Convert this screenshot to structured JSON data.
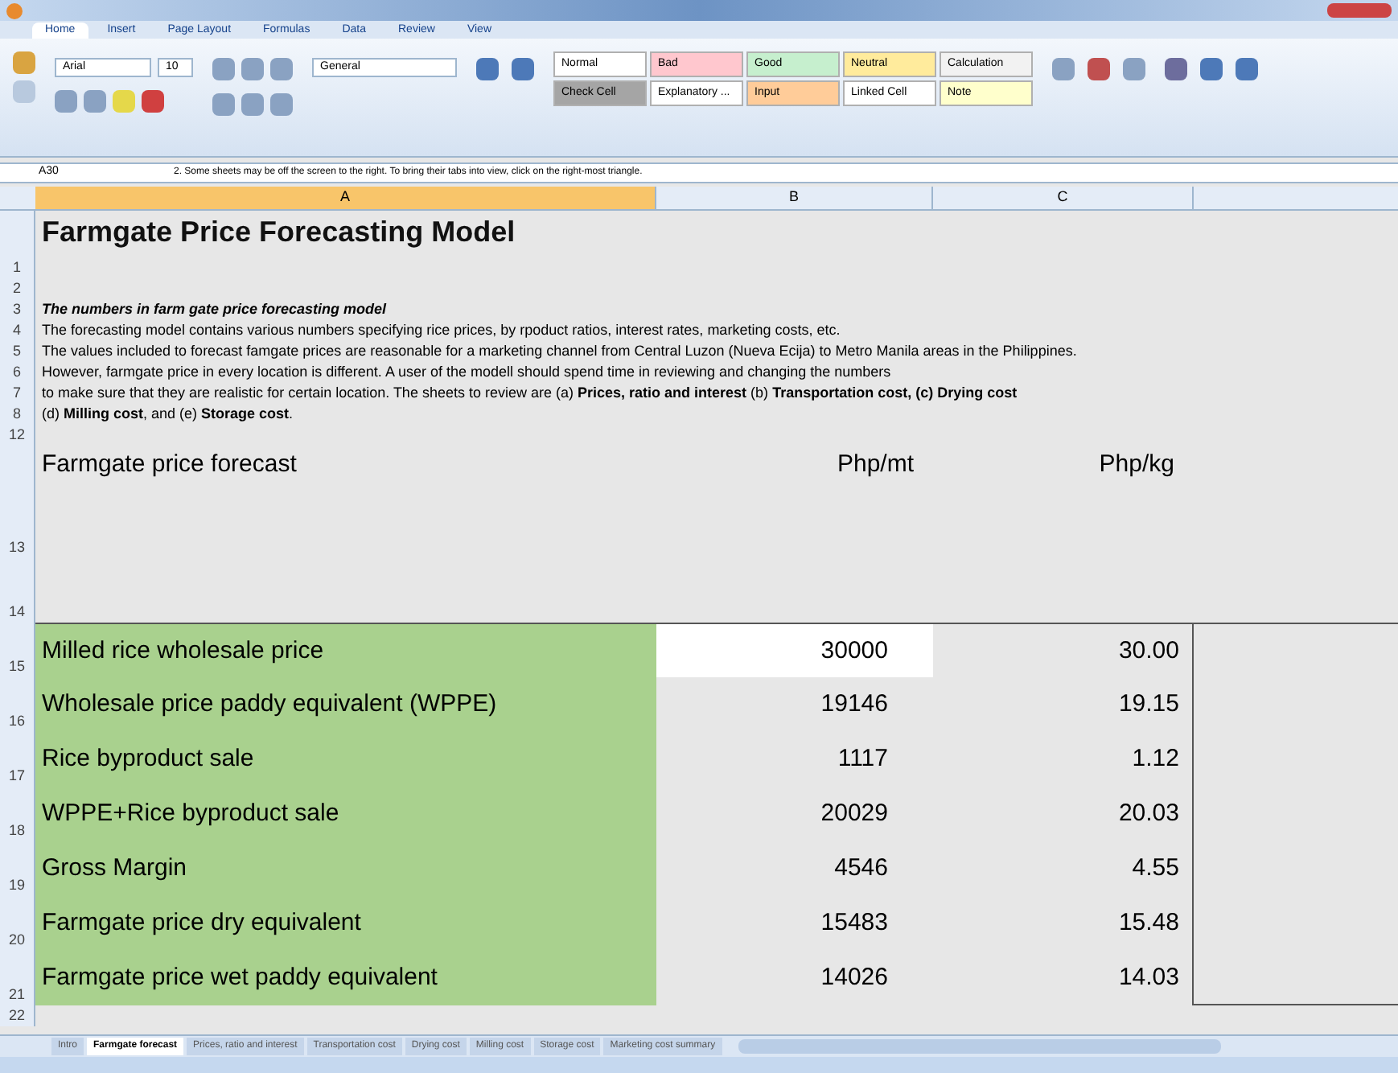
{
  "ribbon": {
    "tabs": [
      {
        "label": "Home",
        "selected": true
      },
      {
        "label": "Insert",
        "selected": false
      },
      {
        "label": "Page Layout",
        "selected": false
      },
      {
        "label": "Formulas",
        "selected": false
      },
      {
        "label": "Data",
        "selected": false
      },
      {
        "label": "Review",
        "selected": false
      },
      {
        "label": "View",
        "selected": false
      }
    ],
    "font_name": "Arial",
    "font_size": "10",
    "number_format": "General",
    "styles": [
      {
        "label": "Normal",
        "color": "#ffffff"
      },
      {
        "label": "Bad",
        "color": "#ffc7ce"
      },
      {
        "label": "Good",
        "color": "#c6efce"
      },
      {
        "label": "Neutral",
        "color": "#ffeb9c"
      },
      {
        "label": "Calculation",
        "color": "#f2f2f2"
      },
      {
        "label": "Check Cell",
        "color": "#a5a5a5"
      },
      {
        "label": "Explanatory ...",
        "color": "#ffffff"
      },
      {
        "label": "Input",
        "color": "#ffcc99"
      },
      {
        "label": "Linked Cell",
        "color": "#ffffff"
      },
      {
        "label": "Note",
        "color": "#ffffcc"
      }
    ]
  },
  "formula_bar": {
    "name_box": "A30",
    "formula": "2. Some sheets may be off the screen to the right. To bring their tabs into view, click on the right-most triangle."
  },
  "columns": [
    {
      "label": "A",
      "selected": true
    },
    {
      "label": "B",
      "selected": false
    },
    {
      "label": "C",
      "selected": false
    }
  ],
  "rows": [
    {
      "number": "1",
      "kind": "title",
      "text": "Farmgate Price Forecasting Model"
    },
    {
      "number": "2",
      "kind": "blank"
    },
    {
      "number": "3",
      "kind": "note-heading",
      "text": "The numbers in farm gate price forecasting model"
    },
    {
      "number": "4",
      "kind": "note",
      "text": "The forecasting model contains various numbers specifying rice prices, by rpoduct ratios, interest rates, marketing costs, etc."
    },
    {
      "number": "5",
      "kind": "note",
      "text": "The values included to forecast famgate prices are reasonable for a marketing channel from Central Luzon (Nueva Ecija) to Metro Manila areas in the Philippines."
    },
    {
      "number": "6",
      "kind": "note",
      "text": "However,  farmgate price in every location is different. A user of the modell should spend time in reviewing and changing the numbers"
    },
    {
      "number": "7",
      "kind": "note",
      "text": "to make sure that they are realistic for certain location. The sheets to review are (a) **Prices, ratio and interest** (b) **Transportation cost, (c) Drying cost**"
    },
    {
      "number": "8",
      "kind": "note",
      "text": "(d) **Milling cost**, and (e) **Storage cost**."
    },
    {
      "number": "12",
      "kind": "blank"
    },
    {
      "number": "13",
      "kind": "header",
      "text": "Farmgate price forecast",
      "b": "Php/mt",
      "c": "Php/kg"
    },
    {
      "number": "14",
      "kind": "spacer"
    },
    {
      "number": "15",
      "kind": "data",
      "text": "Milled rice wholesale price",
      "b": "30000",
      "c": "30.00",
      "highlighted": true
    },
    {
      "number": "16",
      "kind": "data",
      "text": "Wholesale price paddy equivalent (WPPE)",
      "b": "19146",
      "c": "19.15",
      "highlighted": false
    },
    {
      "number": "17",
      "kind": "data",
      "text": "Rice byproduct sale",
      "b": "1117",
      "c": "1.12",
      "highlighted": false
    },
    {
      "number": "18",
      "kind": "data",
      "text": "WPPE+Rice byproduct sale",
      "b": "20029",
      "c": "20.03",
      "highlighted": false
    },
    {
      "number": "19",
      "kind": "data",
      "text": "Gross Margin",
      "b": "4546",
      "c": "4.55",
      "highlighted": false
    },
    {
      "number": "20",
      "kind": "data",
      "text": "Farmgate price dry equivalent",
      "b": "15483",
      "c": "15.48",
      "highlighted": false
    },
    {
      "number": "21",
      "kind": "data",
      "text": "Farmgate price wet paddy equivalent",
      "b": "14026",
      "c": "14.03",
      "highlighted": false
    },
    {
      "number": "22",
      "kind": "blank"
    }
  ],
  "sheet_tabs": [
    {
      "label": "Intro",
      "selected": false
    },
    {
      "label": "Farmgate forecast",
      "selected": true
    },
    {
      "label": "Prices, ratio and interest",
      "selected": false
    },
    {
      "label": "Transportation cost",
      "selected": false
    },
    {
      "label": "Drying cost",
      "selected": false
    },
    {
      "label": "Milling cost",
      "selected": false
    },
    {
      "label": "Storage cost",
      "selected": false
    },
    {
      "label": "Marketing cost summary",
      "selected": false
    }
  ]
}
